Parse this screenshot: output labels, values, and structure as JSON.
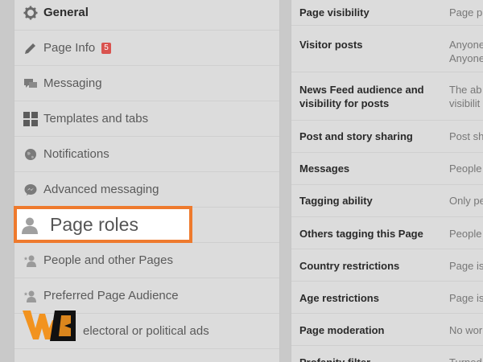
{
  "sidebar": {
    "items": [
      {
        "label": "General",
        "icon": "gear-icon",
        "badge": ""
      },
      {
        "label": "Page Info",
        "icon": "pencil-icon",
        "badge": "5"
      },
      {
        "label": "Messaging",
        "icon": "chat-bubbles-icon",
        "badge": ""
      },
      {
        "label": "Templates and tabs",
        "icon": "grid-icon",
        "badge": ""
      },
      {
        "label": "Notifications",
        "icon": "globe-icon",
        "badge": ""
      },
      {
        "label": "Advanced messaging",
        "icon": "messenger-icon",
        "badge": ""
      },
      {
        "label": "Page roles",
        "icon": "person-icon",
        "badge": ""
      },
      {
        "label": "People and other Pages",
        "icon": "person-star-icon",
        "badge": ""
      },
      {
        "label": "Preferred Page Audience",
        "icon": "person-star-icon",
        "badge": ""
      },
      {
        "label": "electoral or political ads",
        "icon": "",
        "badge": ""
      }
    ]
  },
  "settings": {
    "rows": [
      {
        "label": "Page visibility",
        "value": "Page p"
      },
      {
        "label": "Visitor posts",
        "value": "Anyone\nAnyone"
      },
      {
        "label": "News Feed audience and\nvisibility for posts",
        "value": "The ab\nvisibilit"
      },
      {
        "label": "Post and story sharing",
        "value": "Post sh"
      },
      {
        "label": "Messages",
        "value": "People"
      },
      {
        "label": "Tagging ability",
        "value": "Only pe"
      },
      {
        "label": "Others tagging this Page",
        "value": "People"
      },
      {
        "label": "Country restrictions",
        "value": "Page is"
      },
      {
        "label": "Age restrictions",
        "value": "Page is"
      },
      {
        "label": "Page moderation",
        "value": "No wor"
      },
      {
        "label": "Profanity filter",
        "value": "Turned"
      }
    ]
  },
  "watermark": {
    "text": "WB"
  },
  "colors": {
    "highlight_border": "#ee7a2d",
    "logo_orange": "#f2931f",
    "badge_red": "#d9534f"
  }
}
